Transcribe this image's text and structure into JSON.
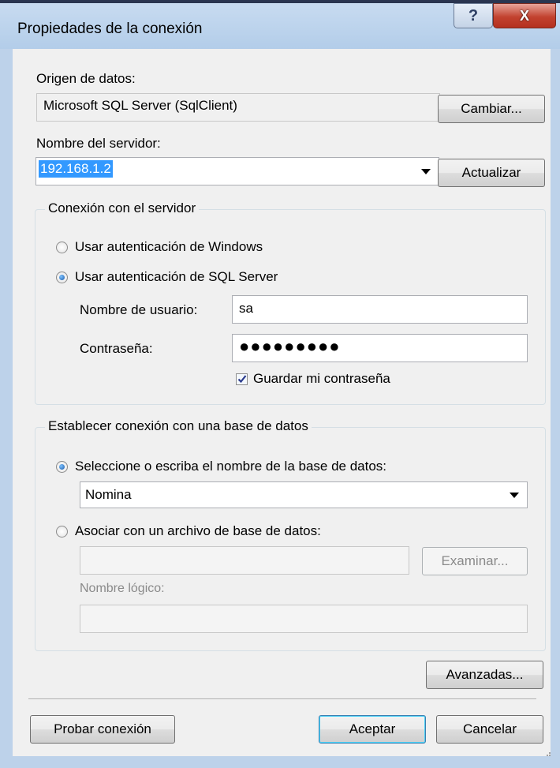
{
  "window": {
    "title": "Propiedades de la conexión",
    "help_glyph": "?",
    "close_glyph": "X"
  },
  "data_source": {
    "label": "Origen de datos:",
    "value": "Microsoft SQL Server (SqlClient)",
    "change_button": "Cambiar..."
  },
  "server": {
    "label": "Nombre del servidor:",
    "value": "192.168.1.2",
    "refresh_button": "Actualizar"
  },
  "auth_group": {
    "title": "Conexión con el servidor",
    "windows_auth_label": "Usar autenticación de Windows",
    "sql_auth_label": "Usar autenticación de SQL Server",
    "selected": "sql",
    "username_label": "Nombre de usuario:",
    "username_value": "sa",
    "password_label": "Contraseña:",
    "password_mask": "●●●●●●●●●",
    "save_password_label": "Guardar mi contraseña",
    "save_password_checked": true
  },
  "db_group": {
    "title": "Establecer conexión con una base de datos",
    "select_db_label": "Seleccione o escriba el nombre de la base de datos:",
    "db_value": "Nomina",
    "attach_file_label": "Asociar con un archivo de base de datos:",
    "browse_button": "Examinar...",
    "logical_name_label": "Nombre lógico:"
  },
  "buttons": {
    "advanced": "Avanzadas...",
    "test": "Probar conexión",
    "ok": "Aceptar",
    "cancel": "Cancelar"
  },
  "icons": {
    "help": "help-icon",
    "close": "close-icon",
    "dropdown": "chevron-down-icon",
    "check": "check-icon",
    "grip": "resize-grip-icon"
  }
}
